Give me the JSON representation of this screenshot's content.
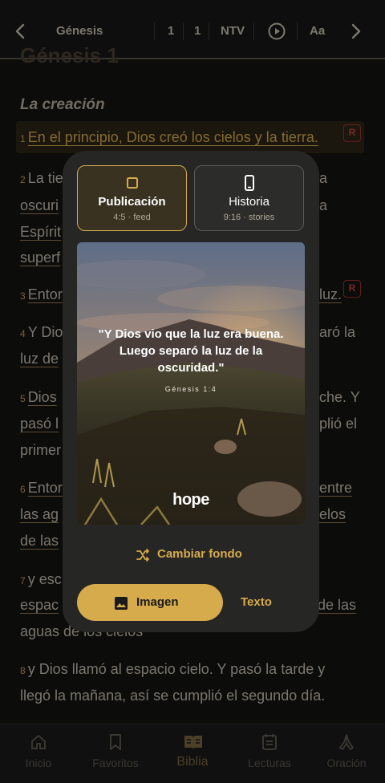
{
  "topbar": {
    "book": "Génesis",
    "chapter": "1",
    "verse": "1",
    "version": "NTV",
    "font_label": "Aa"
  },
  "reader": {
    "chapter_title": "Génesis 1",
    "section_title": "La creación",
    "verses": [
      {
        "n": "1",
        "text": "En el principio, Dios creó los cielos y la tierra."
      },
      {
        "n": "2",
        "text": "La tie"
      },
      {
        "n": "",
        "text": "oscuri"
      },
      {
        "n": "",
        "text": "Espírit"
      },
      {
        "n": "",
        "text": "superf"
      },
      {
        "n": "3",
        "text": "Entor"
      },
      {
        "n": "4",
        "text": "Y Dio"
      },
      {
        "n": "",
        "text": "luz de"
      },
      {
        "n": "5",
        "text": "Dios"
      },
      {
        "n": "",
        "text": "pasó l"
      },
      {
        "n": "",
        "text": "primer"
      },
      {
        "n": "6",
        "text": "Entor"
      },
      {
        "n": "",
        "text": "las ag"
      },
      {
        "n": "",
        "text": "de las"
      },
      {
        "n": "7",
        "text": "y esc"
      },
      {
        "n": "",
        "text": "espac"
      },
      {
        "n": "",
        "text": "aguas de los cielos"
      },
      {
        "n": "8",
        "text": "y Dios llamó al espacio cielo. Y pasó la tarde y"
      },
      {
        "n": "",
        "text": "llegó la mañana, así se cumplió el segundo día."
      }
    ],
    "right_fragments": [
      "a",
      "a",
      "luz.",
      "aró la",
      "che. Y",
      "plió el",
      "entre",
      "elos",
      "de las"
    ],
    "badge": "R"
  },
  "share_modal": {
    "formats": [
      {
        "title": "Publicación",
        "subtitle": "4:5 · feed"
      },
      {
        "title": "Historia",
        "subtitle": "9:16 · stories"
      }
    ],
    "quote": "\"Y Dios vio que la luz era buena. Luego separó la luz de la oscuridad.\"",
    "reference": "Génesis 1:4",
    "logo": "hope",
    "shuffle_label": "Cambiar fondo",
    "image_button": "Imagen",
    "text_button": "Texto"
  },
  "bottom_nav": [
    {
      "label": "Inicio",
      "icon": "home-icon"
    },
    {
      "label": "Favoritos",
      "icon": "bookmark-icon"
    },
    {
      "label": "Biblia",
      "icon": "book-icon"
    },
    {
      "label": "Lecturas",
      "icon": "list-icon"
    },
    {
      "label": "Oración",
      "icon": "pray-icon"
    }
  ],
  "colors": {
    "accent": "#d6ab4c",
    "background": "#141412",
    "modal": "#262624",
    "badge": "#c04040"
  }
}
